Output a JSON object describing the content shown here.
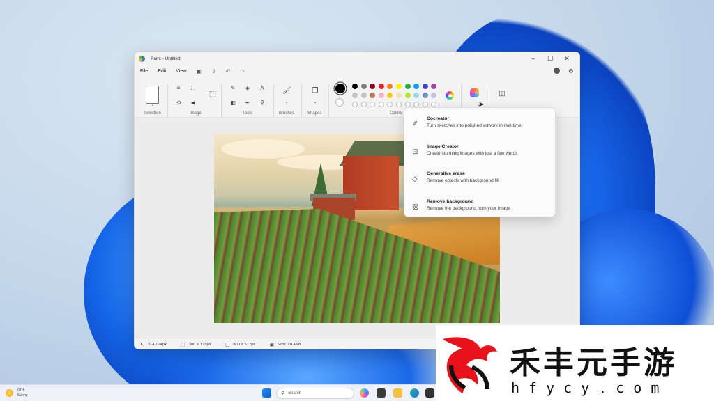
{
  "window": {
    "title": "Paint - Untitled",
    "controls": {
      "minimize": "–",
      "maximize": "☐",
      "close": "✕"
    }
  },
  "menu": {
    "file": "File",
    "edit": "Edit",
    "view": "View"
  },
  "ribbon": {
    "groups": {
      "selection": "Selection",
      "image": "Image",
      "tools": "Tools",
      "brushes": "Brushes",
      "shapes": "Shapes",
      "colors": "Colors"
    },
    "colors_row1": [
      "#000000",
      "#7f7f7f",
      "#880015",
      "#ed1c24",
      "#ff7f27",
      "#fff200",
      "#22b14c",
      "#00a2e8",
      "#3f48cc",
      "#a349a4"
    ],
    "colors_row2": [
      "#c3c3c3",
      "#c3c3c3",
      "#b97a57",
      "#ffaec9",
      "#ffc90e",
      "#efe4b0",
      "#b5e61d",
      "#99d9ea",
      "#7092be",
      "#c8bfe7"
    ]
  },
  "copilot_menu": [
    {
      "title": "Cocreator",
      "desc": "Turn sketches into polished artwork in real time",
      "icon": "brush-sparkle-icon"
    },
    {
      "title": "Image Creator",
      "desc": "Create stunning images with just a few words",
      "icon": "image-sparkle-icon"
    },
    {
      "title": "Generative erase",
      "desc": "Remove objects with background fill",
      "icon": "eraser-sparkle-icon"
    },
    {
      "title": "Remove background",
      "desc": "Remove the background from your image",
      "icon": "background-remove-icon"
    }
  ],
  "status": {
    "cursor_pos": "314,124px",
    "selection_size": "300 × 125px",
    "canvas_size": "800 × 512px",
    "file_size": "Size: 20.4KB"
  },
  "taskbar": {
    "temp": "78°F",
    "condition": "Sunny",
    "search_placeholder": "Search"
  },
  "watermark": {
    "chinese": "禾丰元手游",
    "domain": "hfycy.com"
  }
}
